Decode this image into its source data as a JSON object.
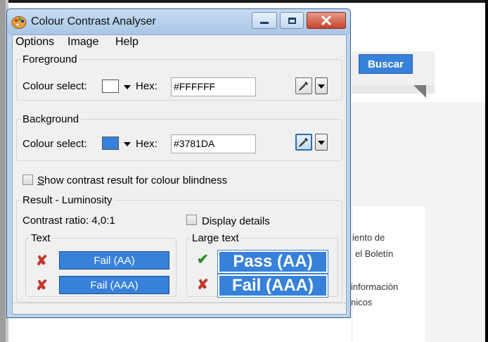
{
  "background_page": {
    "search_button_label": "Buscar",
    "text_lines": [
      "iento de",
      "el Boletín",
      "información",
      "nicos"
    ]
  },
  "window": {
    "title": "Colour Contrast Analyser"
  },
  "menu": {
    "items": [
      "Options",
      "Image",
      "Help"
    ]
  },
  "foreground": {
    "group_title": "Foreground",
    "colour_select_label": "Colour select:",
    "hex_label": "Hex:",
    "hex_value": "#FFFFFF",
    "swatch_color": "#FFFFFF"
  },
  "background": {
    "group_title": "Background",
    "colour_select_label": "Colour select:",
    "hex_label": "Hex:",
    "hex_value": "#3781DA",
    "swatch_color": "#3781DA"
  },
  "colour_blindness": {
    "label": "Show contrast result for colour blindness",
    "checked": false
  },
  "result": {
    "group_title": "Result - Luminosity",
    "contrast_ratio_text": "Contrast ratio: 4,0:1",
    "display_details_label": "Display details",
    "display_details_checked": false,
    "text_group": {
      "title": "Text",
      "aa_label": "Fail (AA)",
      "aaa_label": "Fail (AAA)"
    },
    "large_text_group": {
      "title": "Large text",
      "aa_label": "Pass (AA)",
      "aaa_label": "Fail (AAA)"
    }
  },
  "colors": {
    "result_blue": "#3781DA",
    "fail_mark": "#C0392B",
    "pass_mark": "#2E8B2E"
  }
}
